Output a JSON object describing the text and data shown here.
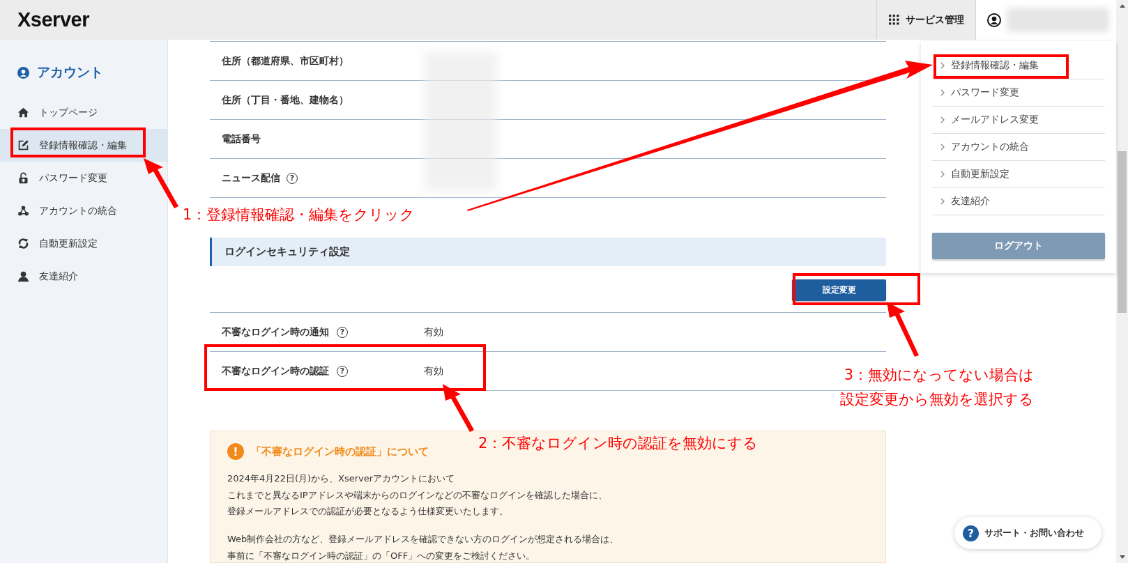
{
  "header": {
    "logo": "Xserver",
    "service_menu": "サービス管理"
  },
  "sidebar": {
    "title": "アカウント",
    "items": [
      {
        "label": "トップページ",
        "selected": false
      },
      {
        "label": "登録情報確認・編集",
        "selected": true
      },
      {
        "label": "パスワード変更",
        "selected": false
      },
      {
        "label": "アカウントの統合",
        "selected": false
      },
      {
        "label": "自動更新設定",
        "selected": false
      },
      {
        "label": "友達紹介",
        "selected": false
      }
    ]
  },
  "profile_rows": [
    {
      "label": "住所（都道府県、市区町村）"
    },
    {
      "label": "住所（丁目・番地、建物名）"
    },
    {
      "label": "電話番号"
    },
    {
      "label": "ニュース配信",
      "help_icon": "?"
    }
  ],
  "section": {
    "title": "ログインセキュリティ設定",
    "button": "設定変更"
  },
  "security_rows": [
    {
      "label": "不審なログイン時の通知",
      "help_icon": "?",
      "value": "有効"
    },
    {
      "label": "不審なログイン時の認証",
      "help_icon": "?",
      "value": "有効"
    }
  ],
  "notice": {
    "icon": "!",
    "title": "「不審なログイン時の認証」について",
    "paragraphs": [
      [
        "2024年4月22日(月)から、Xserverアカウントにおいて",
        "これまでと異なるIPアドレスや端末からのログインなどの不審なログインを確認した場合に、",
        "登録メールアドレスでの認証が必要となるよう仕様変更いたします。"
      ],
      [
        "Web制作会社の方など、登録メールアドレスを確認できない方のログインが想定される場合は、",
        "事前に「不審なログイン時の認証」の「OFF」への変更をご検討ください。"
      ]
    ]
  },
  "dropdown": {
    "items": [
      {
        "label": "登録情報確認・編集"
      },
      {
        "label": "パスワード変更"
      },
      {
        "label": "メールアドレス変更"
      },
      {
        "label": "アカウントの統合"
      },
      {
        "label": "自動更新設定"
      },
      {
        "label": "友達紹介"
      }
    ],
    "logout": "ログアウト"
  },
  "support_button": {
    "icon": "?",
    "label": "サポート・お問い合わせ"
  },
  "annotations": [
    {
      "lines": [
        "1：登録情報確認・編集をクリック"
      ]
    },
    {
      "lines": [
        "2：不審なログイン時の認証を無効にする"
      ]
    },
    {
      "lines": [
        "3：無効になってない場合は",
        "設定変更から無効を選択する"
      ]
    }
  ]
}
